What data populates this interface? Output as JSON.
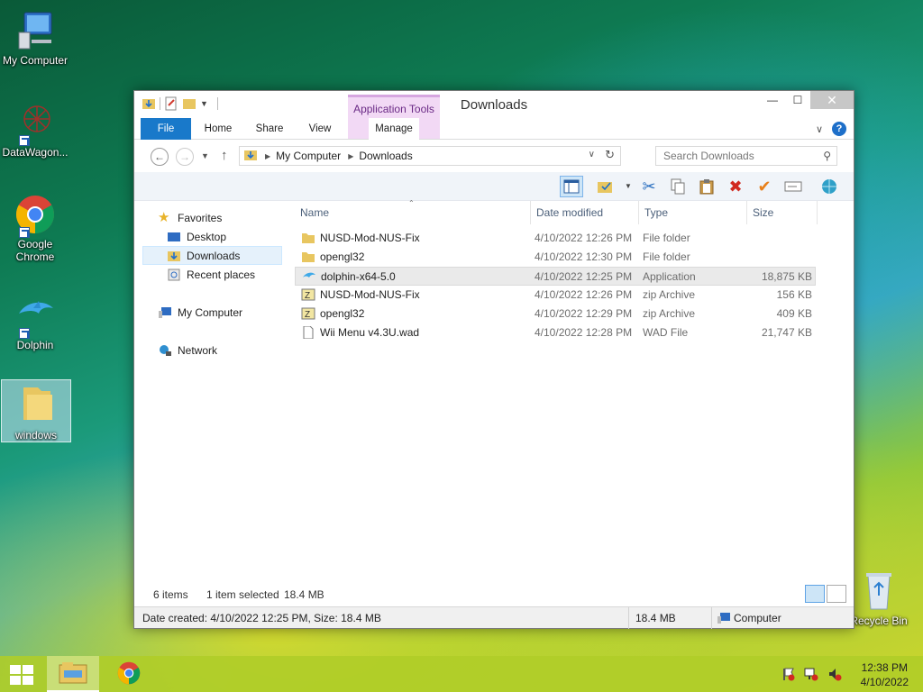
{
  "desktop": {
    "icons": [
      {
        "label": "My Computer"
      },
      {
        "label": "DataWagon..."
      },
      {
        "label": "Google Chrome"
      },
      {
        "label": "Dolphin"
      },
      {
        "label": "windows"
      },
      {
        "label": "Recycle Bin"
      }
    ]
  },
  "window": {
    "title": "Downloads",
    "app_tools": "Application Tools",
    "tabs": [
      "File",
      "Home",
      "Share",
      "View",
      "Manage"
    ],
    "nav": {
      "path": [
        "My Computer",
        "Downloads"
      ],
      "search_placeholder": "Search Downloads"
    },
    "sidebar": {
      "favorites": "Favorites",
      "items": [
        "Desktop",
        "Downloads",
        "Recent places"
      ],
      "computer": "My Computer",
      "network": "Network"
    },
    "columns": [
      "Name",
      "Date modified",
      "Type",
      "Size"
    ],
    "files": [
      {
        "name": "NUSD-Mod-NUS-Fix",
        "date": "4/10/2022 12:26 PM",
        "type": "File folder",
        "size": "",
        "icon": "folder-icon"
      },
      {
        "name": "opengl32",
        "date": "4/10/2022 12:30 PM",
        "type": "File folder",
        "size": "",
        "icon": "folder-icon"
      },
      {
        "name": "dolphin-x64-5.0",
        "date": "4/10/2022 12:25 PM",
        "type": "Application",
        "size": "18,875 KB",
        "icon": "dolphin-app-icon",
        "selected": true
      },
      {
        "name": "NUSD-Mod-NUS-Fix",
        "date": "4/10/2022 12:26 PM",
        "type": "zip Archive",
        "size": "156 KB",
        "icon": "zip-archive-icon"
      },
      {
        "name": "opengl32",
        "date": "4/10/2022 12:29 PM",
        "type": "zip Archive",
        "size": "409 KB",
        "icon": "zip-archive-icon"
      },
      {
        "name": "Wii Menu v4.3U.wad",
        "date": "4/10/2022 12:28 PM",
        "type": "WAD File",
        "size": "21,747 KB",
        "icon": "file-icon"
      }
    ],
    "status": {
      "items": "6 items",
      "selected": "1 item selected",
      "selected_size": "18.4 MB"
    },
    "details": {
      "info": "Date created: 4/10/2022 12:25 PM, Size: 18.4 MB",
      "size": "18.4 MB",
      "location": "Computer"
    }
  },
  "taskbar": {
    "time": "12:38 PM",
    "date": "4/10/2022"
  }
}
